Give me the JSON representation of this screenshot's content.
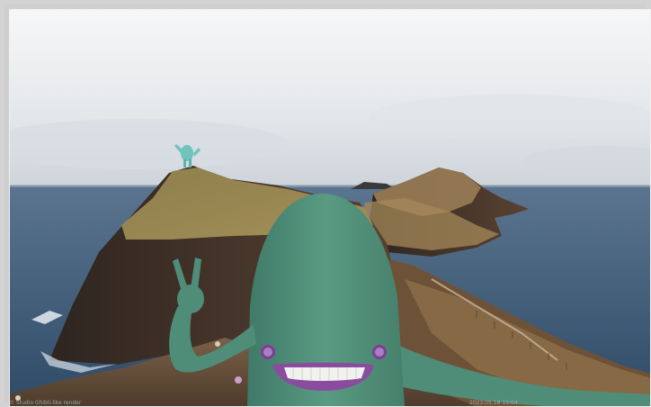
{
  "scene": {
    "description_icon": "photo-with-3d-creatures",
    "colors": {
      "sky": "#e9edf1",
      "sea": "#3f5c78",
      "cliff": "#3b2f28",
      "grass": "#8a7b4a",
      "creature": "#4f8d78",
      "small_creature": "#6fc4bd",
      "mouth": "#8a4c9e"
    }
  },
  "captions": {
    "left": "© Studio Ghibli-like render",
    "right": "2023.05.18 15:04"
  }
}
